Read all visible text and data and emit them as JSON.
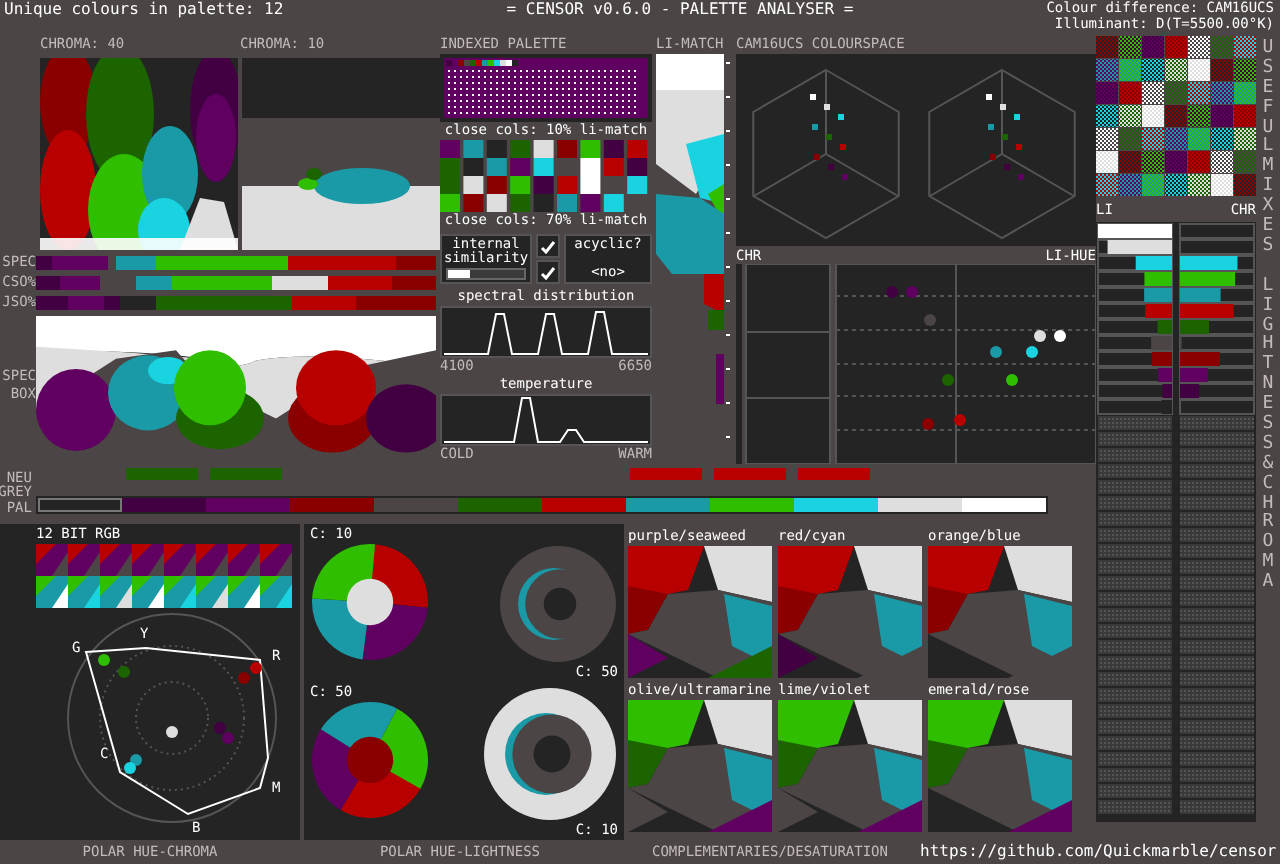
{
  "header": {
    "unique_colours": "Unique colours in palette: 12",
    "title": "= CENSOR v0.6.0 - PALETTE ANALYSER =",
    "colour_difference": "Colour difference: CAM16UCS",
    "illuminant": "Illuminant: D(T=5500.00°K)"
  },
  "palette": [
    {
      "color": "#242424"
    },
    {
      "color": "#420042"
    },
    {
      "color": "#600060"
    },
    {
      "color": "#8a0000"
    },
    {
      "color": "#4b4545"
    },
    {
      "color": "#1c6400"
    },
    {
      "color": "#b90000"
    },
    {
      "color": "#1a99a6"
    },
    {
      "color": "#2fbe00"
    },
    {
      "color": "#1ad3e0"
    },
    {
      "color": "#dedede"
    },
    {
      "color": "#ffffff"
    }
  ],
  "chroma_maps": [
    {
      "label": "CHROMA: 40"
    },
    {
      "label": "CHROMA: 10"
    }
  ],
  "spectrum_bars": [
    {
      "label": "SPEC"
    },
    {
      "label": "CSO%"
    },
    {
      "label": "JSO%"
    }
  ],
  "spec_box": {
    "label_lines": [
      "SPEC",
      "BOX"
    ]
  },
  "indexed_palette": {
    "title": "INDEXED PALETTE"
  },
  "close_cols": [
    {
      "label": "close cols: 10% li-match"
    },
    {
      "label": "close cols: 70% li-match"
    }
  ],
  "internal_similarity": {
    "label": "internal similarity",
    "level": 0.3,
    "checks": [
      {
        "checked": true
      },
      {
        "checked": true
      }
    ]
  },
  "acyclic": {
    "label": "acyclic?",
    "value": "<no>"
  },
  "spectral": {
    "title": "spectral distribution",
    "min": "4100",
    "max": "6650"
  },
  "temperature": {
    "title": "temperature",
    "min": "COLD",
    "max": "WARM"
  },
  "li_match": {
    "title": "LI-MATCH"
  },
  "colourspace": {
    "title": "CAM16UCS COLOURSPACE",
    "chr_label": "CHR",
    "li_hue_label": "LI-HUE"
  },
  "useful_mixes": {
    "title": "USEFUL MIXES"
  },
  "lightness_chroma": {
    "title": "LIGHTNESS & CHROMA",
    "li_label": "LI",
    "chr_label": "CHR"
  },
  "grey_labels": [
    "NEU",
    "GREY"
  ],
  "pal_label": "PAL",
  "rgb12": {
    "title": "12 BIT RGB"
  },
  "polar_chroma": {
    "hue_letters": [
      "G",
      "Y",
      "R",
      "C",
      "M",
      "B"
    ],
    "caption": "POLAR HUE-CHROMA"
  },
  "polar_lightness": {
    "caption": "POLAR HUE-LIGHTNESS",
    "rings": [
      {
        "label": "C: 10"
      },
      {
        "label": "C: 50"
      },
      {
        "label": "C: 50"
      },
      {
        "label": "C: 10"
      }
    ]
  },
  "complementaries": {
    "caption": "COMPLEMENTARIES/DESATURATION",
    "pairs": [
      {
        "label": "purple/seaweed"
      },
      {
        "label": "red/cyan"
      },
      {
        "label": "orange/blue"
      },
      {
        "label": "olive/ultramarine"
      },
      {
        "label": "lime/violet"
      },
      {
        "label": "emerald/rose"
      }
    ]
  },
  "link": "https://github.com/Quickmarble/censor"
}
